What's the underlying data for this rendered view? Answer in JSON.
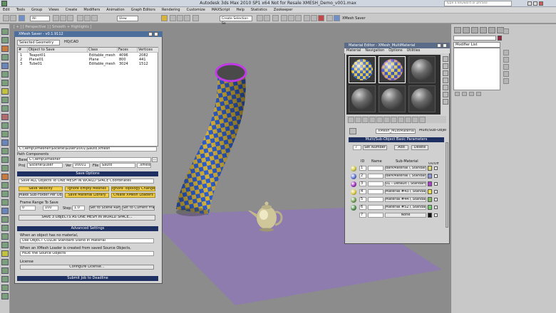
{
  "app": {
    "title": "Autodesk 3ds Max  2010 SP1 x64    Not for Resale   XMESH_Demo_v001.max"
  },
  "menu": [
    "Edit",
    "Tools",
    "Group",
    "Views",
    "Create",
    "Modifiers",
    "Animation",
    "Graph Editors",
    "Rendering",
    "Customize",
    "MAXScript",
    "Help",
    "Statistics",
    "Zookeeper"
  ],
  "toolbar": {
    "selection_filter": "All",
    "view_dropdown": "View",
    "selection_set": "Create Selection Se",
    "xmesh_saver_label": "XMesh Saver",
    "search_placeholder": "Type a keyword or phrase"
  },
  "viewport": {
    "label": "[ + ] [ Perspective ] [ Smooth + Highlights ]"
  },
  "command_panel": {
    "modifier_list": "Modifier List"
  },
  "xmesh": {
    "title": "XMesh Saver - v0.1.9112",
    "selection_mode": "Selected Geometry",
    "hq_label": "HQ/CAD",
    "columns": [
      "#",
      "Object to Save",
      "Class",
      "Faces",
      "Vertices"
    ],
    "rows": [
      {
        "num": "1",
        "name": "Teapot01",
        "cls": "Editable_mesh",
        "faces": "4096",
        "verts": "2082"
      },
      {
        "num": "2",
        "name": "Plane01",
        "cls": "Plane",
        "faces": "800",
        "verts": "441"
      },
      {
        "num": "3",
        "name": "Tube01",
        "cls": "Editable_mesh",
        "faces": "3024",
        "verts": "1512"
      }
    ],
    "output_path": "C:\\Temp\\xmesher\\$scene\\$user\\v001\\$auto.xmesh",
    "path_components": "Path Components",
    "base_label": "Base",
    "base_value": "C:\\Temp\\xmesher",
    "proj_label": "Proj",
    "proj_value": "$scene\\$user",
    "ver_label": "Ver",
    "ver_value": "v0001",
    "file_label": "File",
    "file_value": "$auto",
    "ext_value": ".xmesh",
    "save_options_header": "Save Options",
    "save_mode": "Save ALL Objects To ONE MESH IN WORLD SPACE Coordinates",
    "opt_buttons": [
      "Save Velocity",
      "Ignore Empty Meshes",
      "Ignore Topology Changes",
      "Make Sub-Folder Per Object",
      "Save Material Library",
      "Create XMesh Loaders"
    ],
    "frame_range_label": "Frame Range To Save",
    "frame_start": "0",
    "frame_end": "100",
    "step_label": "Step:",
    "step_value": "1.0",
    "scene_range_btn": "Set to Scene Range",
    "current_frame_btn": "Set to Current Frame",
    "save_btn": "SAVE 3 OBJECTS AS ONE MESH IN WORLD SPACE...",
    "advanced_header": "Advanced Settings",
    "no_material_label": "When an object has no material,",
    "no_material_value": "Use OBJECT COLOR Standard Stand In Material",
    "loader_label": "When an XMesh Loader is created from saved Source Objects,",
    "loader_value": "HIDE the Source Objects",
    "license_label": "License",
    "configure_btn": "Configure License...",
    "submit_btn": "Submit Job to Deadline"
  },
  "material_editor": {
    "title": "Material Editor - XMesh_MultiMaterial",
    "menu": [
      "Material",
      "Navigation",
      "Options",
      "Utilities"
    ],
    "material_name": "XMesh_MultiMaterial",
    "material_type": "Multi/Sub-Object",
    "rollout_header": "Multi/Sub-Object Basic Parameters",
    "count": "7",
    "set_number_btn": "Set Number",
    "add_btn": "Add",
    "delete_btn": "Delete",
    "col_id": "ID",
    "col_name": "Name",
    "col_sub": "Sub-Material",
    "col_onoff": "On/Off",
    "rows": [
      {
        "id": "1",
        "sub": "darkMaterial  ( Standard )",
        "swatch": "#c8c23a",
        "color": "#e0d96a"
      },
      {
        "id": "2",
        "sub": "darkMaterial  ( Standard )",
        "swatch": "#5a6fd0",
        "color": "#8b95dd"
      },
      {
        "id": "3",
        "sub": "01 - Default  ( Standard )",
        "swatch": "#9a2bb8",
        "color": "#b03ad0"
      },
      {
        "id": "4",
        "sub": "Material #43  ( Standard )",
        "swatch": "#d8c63a",
        "color": "#efe04a"
      },
      {
        "id": "5",
        "sub": "Material #44  ( Standard )",
        "swatch": "#6a9a4a",
        "color": "#7fbf5a"
      },
      {
        "id": "6",
        "sub": "Material #52  ( Standard )",
        "swatch": "#4a8a4a",
        "color": "#6fcf6a"
      },
      {
        "id": "7",
        "sub": "None",
        "swatch": "#cfcfcf",
        "color": "#111111"
      }
    ]
  }
}
